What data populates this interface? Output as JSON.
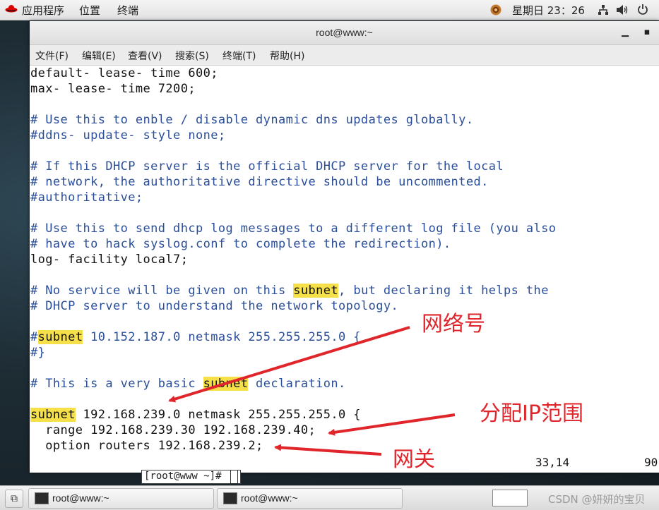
{
  "top_panel": {
    "menu_apps": "应用程序",
    "menu_places": "位置",
    "menu_terminal": "终端",
    "datetime": "星期日 23：26"
  },
  "window": {
    "title": "root@www:~",
    "menus": [
      "文件(F)",
      "编辑(E)",
      "查看(V)",
      "搜索(S)",
      "终端(T)",
      "帮助(H)"
    ]
  },
  "terminal": {
    "lines": [
      {
        "type": "text",
        "text": "default- lease- time 600;"
      },
      {
        "type": "text",
        "text": "max- lease- time 7200;"
      },
      {
        "type": "blank",
        "text": ""
      },
      {
        "type": "comment",
        "text": "# Use this to enble / disable dynamic dns updates globally."
      },
      {
        "type": "comment",
        "text": "#ddns- update- style none;"
      },
      {
        "type": "blank",
        "text": ""
      },
      {
        "type": "comment",
        "text": "# If this DHCP server is the official DHCP server for the local"
      },
      {
        "type": "comment",
        "text": "# network, the authoritative directive should be uncommented."
      },
      {
        "type": "comment",
        "text": "#authoritative;"
      },
      {
        "type": "blank",
        "text": ""
      },
      {
        "type": "comment",
        "text": "# Use this to send dhcp log messages to a different log file (you also"
      },
      {
        "type": "comment",
        "text": "# have to hack syslog.conf to complete the redirection)."
      },
      {
        "type": "text",
        "text": "log- facility local7;"
      },
      {
        "type": "blank",
        "text": ""
      },
      {
        "type": "comment",
        "before": "# No service will be given on this ",
        "hl": "subnet",
        "after": ", but declaring it helps the"
      },
      {
        "type": "comment",
        "text": "# DHCP server to understand the network topology."
      },
      {
        "type": "blank",
        "text": ""
      },
      {
        "type": "comment",
        "before": "#",
        "hl": "subnet",
        "after": " 10.152.187.0 netmask 255.255.255.0 {"
      },
      {
        "type": "comment",
        "text": "#}"
      },
      {
        "type": "blank",
        "text": ""
      },
      {
        "type": "comment",
        "before": "# This is a very basic ",
        "hl": "subnet",
        "after": " declaration."
      },
      {
        "type": "blank",
        "text": ""
      },
      {
        "type": "text",
        "before": "",
        "hl": "subnet",
        "after": " 192.168.239.0 netmask 255.255.255.0 {"
      },
      {
        "type": "text",
        "text": "  range 192.168.239.30 192.168.239.40;"
      },
      {
        "type": "text",
        "text": "  option routers 192.168.239.2;"
      }
    ],
    "cursor_pos": "33,14",
    "scroll_percent": "90"
  },
  "under_prompt": "[root@www ~]# ",
  "annotations": {
    "network_number": "网络号",
    "ip_range": "分配IP范围",
    "gateway": "网关"
  },
  "taskbar": {
    "tasks": [
      "root@www:~",
      "root@www:~"
    ],
    "watermark": "CSDN @妍妍的宝贝"
  },
  "colors": {
    "comment": "#2a4e9a",
    "highlight": "#f5e04a",
    "annotation": "#e0252b"
  }
}
